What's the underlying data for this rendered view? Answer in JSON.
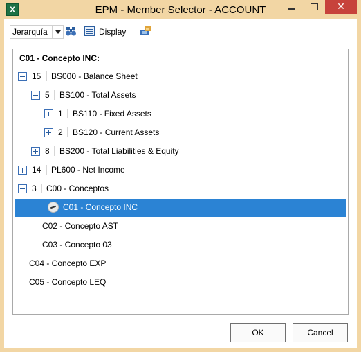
{
  "window": {
    "title": "EPM - Member Selector - ACCOUNT",
    "app_icon_letter": "X",
    "close_glyph": "✕"
  },
  "toolbar": {
    "hierarchy_value": "Jerarquía",
    "display_label": "Display"
  },
  "tree": {
    "header": "C01 - Concepto INC:",
    "rows": [
      {
        "indent": 0,
        "expander": "minus",
        "count": "15",
        "label": "BS000 - Balance Sheet"
      },
      {
        "indent": 1,
        "expander": "minus",
        "count": "5",
        "label": "BS100 - Total Assets"
      },
      {
        "indent": 2,
        "expander": "plus",
        "count": "1",
        "label": "BS110 - Fixed Assets"
      },
      {
        "indent": 2,
        "expander": "plus",
        "count": "2",
        "label": "BS120 - Current Assets"
      },
      {
        "indent": 1,
        "expander": "plus",
        "count": "8",
        "label": "BS200 - Total Liabilities & Equity"
      },
      {
        "indent": 0,
        "expander": "plus",
        "count": "14",
        "label": "PL600 - Net Income"
      },
      {
        "indent": 0,
        "expander": "minus",
        "count": "3",
        "label": "C00 - Conceptos"
      },
      {
        "indent": 1,
        "expander": "none",
        "count": "",
        "label": "C01 - Concepto INC",
        "selected": true
      },
      {
        "indent": 1,
        "expander": "none",
        "count": "",
        "label": "C02 - Concepto AST"
      },
      {
        "indent": 1,
        "expander": "none",
        "count": "",
        "label": "C03 - Concepto 03"
      },
      {
        "indent": 0,
        "expander": "none",
        "count": "",
        "label": "C04 - Concepto EXP"
      },
      {
        "indent": 0,
        "expander": "none",
        "count": "",
        "label": "C05 - Concepto LEQ"
      }
    ]
  },
  "buttons": {
    "ok": "OK",
    "cancel": "Cancel"
  },
  "colors": {
    "selection": "#2b83d4",
    "close_button": "#c7423b",
    "frame": "#f2d6a4"
  }
}
